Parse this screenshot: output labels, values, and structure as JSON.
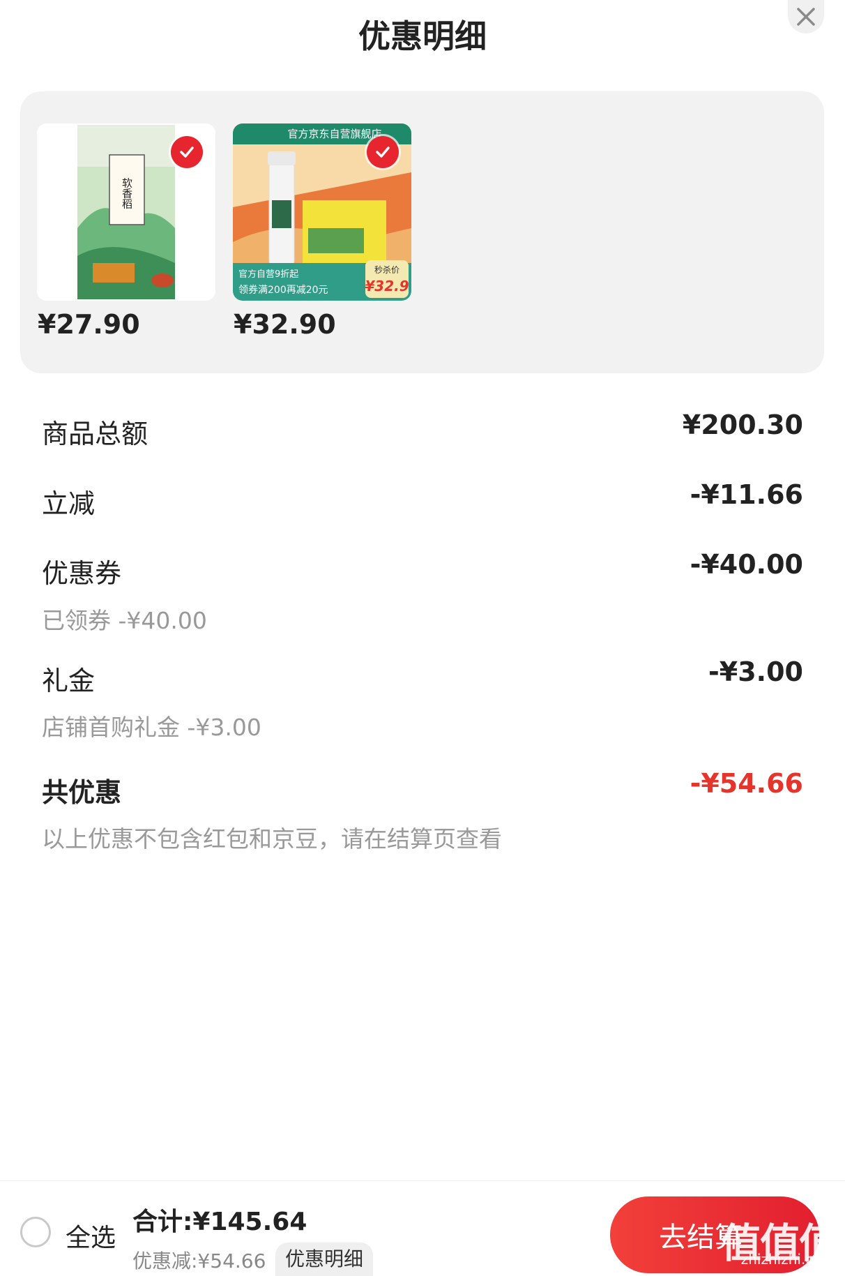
{
  "header": {
    "title": "优惠明细"
  },
  "products": [
    {
      "price": "¥27.90",
      "image": "rice-bag-image",
      "checked": true,
      "pack_text": "软香稻"
    },
    {
      "price": "¥32.90",
      "image": "water-bottle-image",
      "checked": true,
      "banner_text": "官方京东自营旗舰店",
      "promo_line1": "官方自营9折起",
      "promo_line2": "领券满200再减20元",
      "flash_label": "秒杀价",
      "flash_price": "¥32.9"
    }
  ],
  "details": {
    "total_label": "商品总额",
    "total_value": "¥200.30",
    "instant_label": "立减",
    "instant_value": "-¥11.66",
    "coupon_label": "优惠券",
    "coupon_value": "-¥40.00",
    "coupon_sub": "已领券 -¥40.00",
    "gift_label": "礼金",
    "gift_value": "-¥3.00",
    "gift_sub": "店铺首购礼金 -¥3.00",
    "sum_label": "共优惠",
    "sum_value": "-¥54.66",
    "note": "以上优惠不包含红包和京豆，请在结算页查看"
  },
  "footer": {
    "select_all": "全选",
    "total": "合计:¥145.64",
    "saved": "优惠减:¥54.66",
    "detail_link": "优惠明细",
    "checkout": "去结算",
    "watermark": "值值值",
    "watermark_url": "zhizhizhi.com"
  },
  "colors": {
    "accent": "#e4342c",
    "check": "#e6252e"
  }
}
